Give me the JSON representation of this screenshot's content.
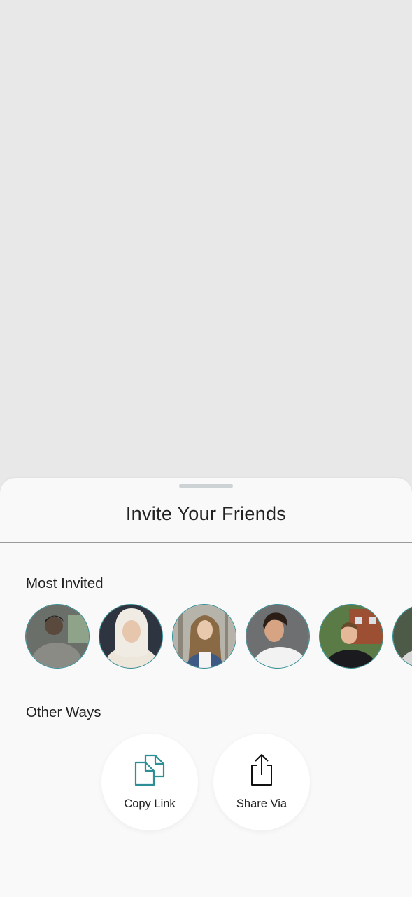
{
  "sheet": {
    "title": "Invite Your Friends",
    "most_invited_label": "Most Invited",
    "other_ways_label": "Other Ways"
  },
  "avatars": [
    {
      "name": "avatar-1",
      "bg": "#6b6f6a",
      "skin": "#5a4a3e",
      "hair": "#1c1c1c",
      "cloth": "#8b8b85"
    },
    {
      "name": "avatar-2",
      "bg": "#2f3540",
      "skin": "#e6c6ad",
      "hair": "#f1ece3",
      "cloth": "#ede6da"
    },
    {
      "name": "avatar-3",
      "bg": "#b6b3ab",
      "skin": "#e9c9ad",
      "hair": "#8a6a45",
      "cloth": "#3d5a84"
    },
    {
      "name": "avatar-4",
      "bg": "#6e6f70",
      "skin": "#d6a483",
      "hair": "#2a1e17",
      "cloth": "#f2f2f2"
    },
    {
      "name": "avatar-5",
      "bg": "#5a7a46",
      "skin": "#e6b89a",
      "hair": "#6a4a2c",
      "cloth": "#1b1b1f"
    },
    {
      "name": "avatar-6",
      "bg": "#4e5a48",
      "skin": "#e1c2a6",
      "hair": "#3b2e22",
      "cloth": "#d8d8d8"
    }
  ],
  "actions": [
    {
      "label": "Copy Link",
      "icon": "copy-link-icon",
      "color": "#2d8f95"
    },
    {
      "label": "Share Via",
      "icon": "share-icon",
      "color": "#111111"
    }
  ]
}
